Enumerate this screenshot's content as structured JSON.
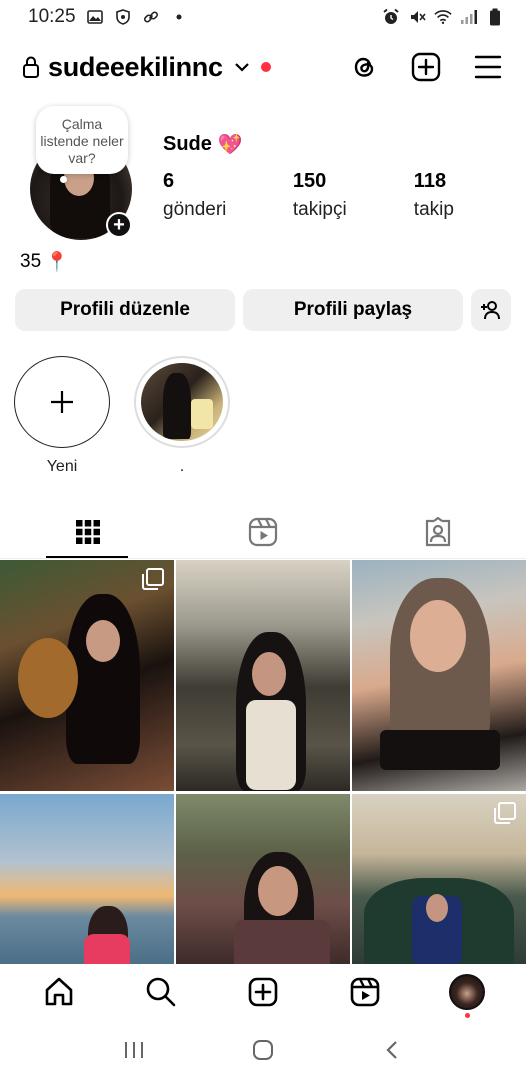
{
  "status_bar": {
    "time": "10:25",
    "left_icons": [
      "image-icon",
      "shield-icon",
      "link-icon",
      "dot-icon"
    ],
    "right_icons": [
      "alarm-icon",
      "mute-icon",
      "wifi-icon",
      "signal-icon",
      "battery-icon"
    ]
  },
  "header": {
    "username": "sudeeekilinnc",
    "notification_dot_color": "#ff3040",
    "actions": [
      "threads-icon",
      "create-icon",
      "menu-icon"
    ]
  },
  "profile": {
    "note_text": "Çalma listende neler var?",
    "display_name": "Sude",
    "display_name_emoji": "💖",
    "stats": [
      {
        "count": "6",
        "label": "gönderi"
      },
      {
        "count": "150",
        "label": "takipçi"
      },
      {
        "count": "118",
        "label": "takip"
      }
    ],
    "bio": "35",
    "bio_emoji": "📍"
  },
  "buttons": {
    "edit_profile": "Profili düzenle",
    "share_profile": "Profili paylaş"
  },
  "highlights": [
    {
      "label": "Yeni",
      "type": "new"
    },
    {
      "label": ".",
      "type": "story"
    }
  ],
  "tabs": [
    {
      "name": "grid",
      "icon": "grid-icon",
      "active": true
    },
    {
      "name": "reels",
      "icon": "reels-icon",
      "active": false
    },
    {
      "name": "tagged",
      "icon": "tagged-icon",
      "active": false
    }
  ],
  "posts": [
    {
      "multi": true
    },
    {
      "multi": false
    },
    {
      "multi": false
    },
    {
      "multi": false
    },
    {
      "multi": false
    },
    {
      "multi": true
    }
  ],
  "bottom_nav": [
    "home-icon",
    "search-icon",
    "create-icon",
    "reels-icon",
    "profile-avatar"
  ],
  "system_nav": [
    "recents-icon",
    "home-button-icon",
    "back-icon"
  ]
}
